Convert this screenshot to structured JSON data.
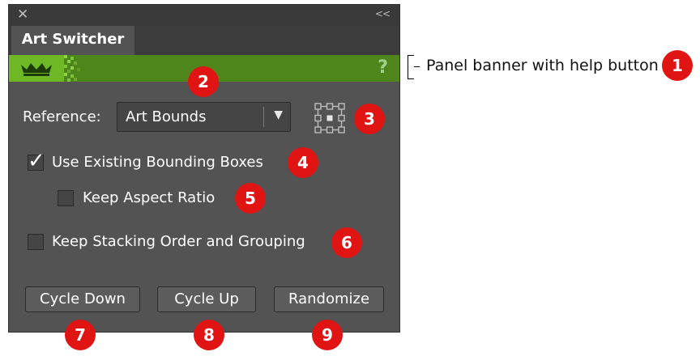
{
  "panel": {
    "close_icon": "close-icon",
    "collapse_label": "<<",
    "tab_title": "Art Switcher",
    "banner": {
      "logo_icon": "crown-icon",
      "help_label": "?",
      "colors": {
        "logo_bg": "#6eb826",
        "banner_bg": "#4e861c"
      }
    },
    "reference": {
      "label": "Reference:",
      "selected": "Art Bounds",
      "reference_point_icon": "reference-point-icon"
    },
    "options": [
      {
        "label": "Use Existing Bounding Boxes",
        "checked": true
      },
      {
        "label": "Keep Aspect Ratio",
        "checked": false
      },
      {
        "label": "Keep Stacking Order and Grouping",
        "checked": false
      }
    ],
    "buttons": {
      "cycle_down": "Cycle Down",
      "cycle_up": "Cycle Up",
      "randomize": "Randomize"
    }
  },
  "annotations": {
    "callout_text": "Panel banner with help button",
    "badges": [
      "1",
      "2",
      "3",
      "4",
      "5",
      "6",
      "7",
      "8",
      "9"
    ],
    "badge_color": "#e11414"
  }
}
